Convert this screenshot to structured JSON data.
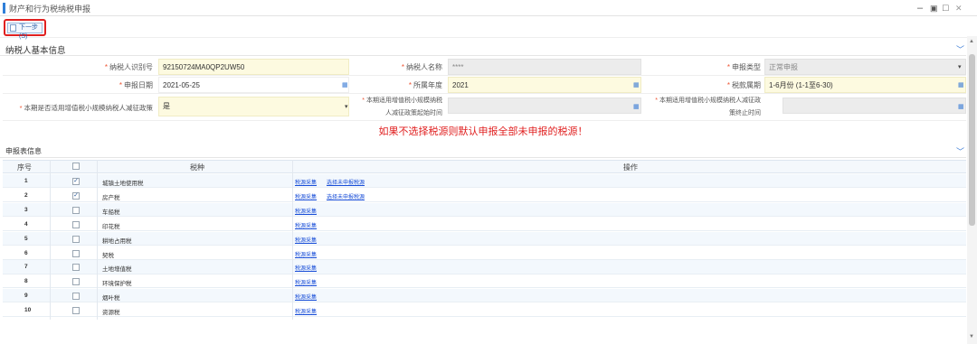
{
  "window": {
    "title": "财产和行为税纳税申报",
    "minimize": "–",
    "restore": "▣",
    "maximize": "□",
    "close": "✕"
  },
  "toolbar": {
    "next_label": "下一步(S)"
  },
  "basic_info": {
    "heading": "纳税人基本信息",
    "taxpayer_id": {
      "label": "纳税人识别号",
      "value": "92150724MA0QP2UW50"
    },
    "taxpayer_name": {
      "label": "纳税人名称",
      "value": "****"
    },
    "declare_type": {
      "label": "申报类型",
      "value": "正常申报"
    },
    "declare_date": {
      "label": "申报日期",
      "value": "2021-05-25"
    },
    "year": {
      "label": "所属年度",
      "value": "2021"
    },
    "period": {
      "label": "税款属期",
      "value": "1-6月份 (1-1至6-30)"
    },
    "policy": {
      "label": "本期是否适用增值税小规模纳税人减征政策",
      "value": "是"
    },
    "policy_start": {
      "label_line1": "本期适用增值税小规模纳税",
      "label_line2": "人减征政策起始时间",
      "value": ""
    },
    "policy_end": {
      "label_line1": "本期适用增值税小规模纳税人减征政",
      "label_line2": "策终止时间",
      "value": ""
    }
  },
  "warning": "如果不选择税源则默认申报全部未申报的税源！",
  "table": {
    "heading": "申报表信息",
    "col_no": "序号",
    "col_tax": "税种",
    "col_op": "操作",
    "rows": [
      {
        "no": "1",
        "tax": "城镇土地使用税",
        "checked": "✓",
        "link1": "税源采集",
        "link2": "选择未申报税源"
      },
      {
        "no": "2",
        "tax": "房产税",
        "checked": "✓",
        "link1": "税源采集",
        "link2": "选择未申报税源"
      },
      {
        "no": "3",
        "tax": "车船税",
        "checked": "",
        "link1": "税源采集",
        "link2": ""
      },
      {
        "no": "4",
        "tax": "印花税",
        "checked": "",
        "link1": "税源采集",
        "link2": ""
      },
      {
        "no": "5",
        "tax": "耕地占用税",
        "checked": "",
        "link1": "税源采集",
        "link2": ""
      },
      {
        "no": "6",
        "tax": "契税",
        "checked": "",
        "link1": "税源采集",
        "link2": ""
      },
      {
        "no": "7",
        "tax": "土地增值税",
        "checked": "",
        "link1": "税源采集",
        "link2": ""
      },
      {
        "no": "8",
        "tax": "环境保护税",
        "checked": "",
        "link1": "税源采集",
        "link2": ""
      },
      {
        "no": "9",
        "tax": "烟叶税",
        "checked": "",
        "link1": "税源采集",
        "link2": ""
      },
      {
        "no": "10",
        "tax": "资源税",
        "checked": "",
        "link1": "税源采集",
        "link2": ""
      }
    ]
  },
  "icons": {
    "calendar": "calendar-icon",
    "chevron": "chevron-down-icon"
  },
  "colors": {
    "accent": "#2f7fd9",
    "warning": "#e02020",
    "link": "#1a4fd8",
    "required": "#e55533",
    "yellow_field": "#fdfae0"
  }
}
